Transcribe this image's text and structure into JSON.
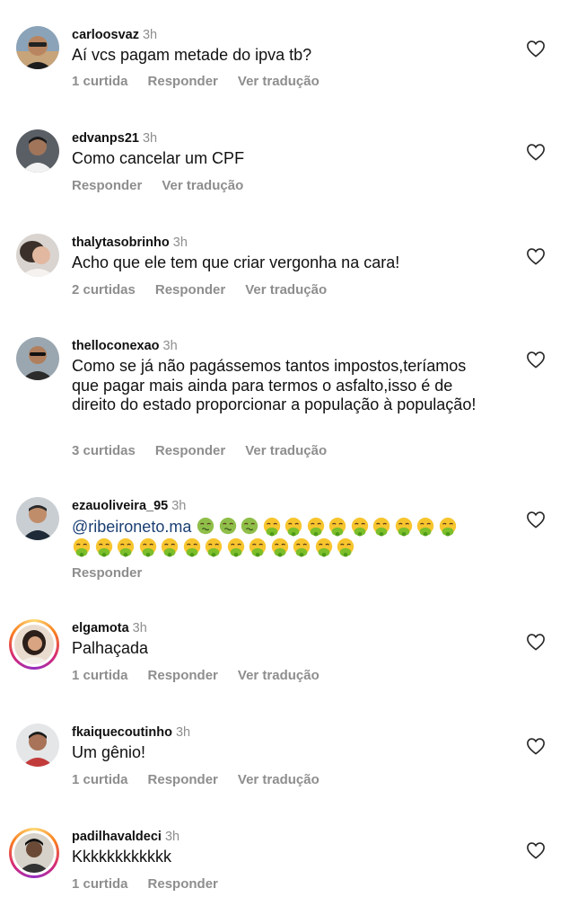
{
  "comments": [
    {
      "username": "carloosvaz",
      "time": "3h",
      "text": "Aí vcs pagam metade do ipva tb?",
      "likes": "1 curtida",
      "reply": "Responder",
      "translate": "Ver tradução"
    },
    {
      "username": "edvanps21",
      "time": "3h",
      "text": "Como cancelar um CPF",
      "reply": "Responder",
      "translate": "Ver tradução"
    },
    {
      "username": "thalytasobrinho",
      "time": "3h",
      "text": "Acho que ele tem que criar vergonha na cara!",
      "likes": "2 curtidas",
      "reply": "Responder",
      "translate": "Ver tradução"
    },
    {
      "username": "thelloconexao",
      "time": "3h",
      "text": "Como se já não pagássemos tantos impostos,teríamos que pagar mais ainda para termos o asfalto,isso é de direito do estado proporcionar a população à população!",
      "likes": "3 curtidas",
      "reply": "Responder",
      "translate": "Ver tradução"
    },
    {
      "username": "ezauoliveira_95",
      "time": "3h",
      "mention": "@ribeironeto.ma",
      "emoji": {
        "nauseated": 3,
        "vomiting": 9,
        "vomiting_line2": 13
      },
      "reply": "Responder"
    },
    {
      "username": "elgamota",
      "time": "3h",
      "text": "Palhaçada",
      "likes": "1 curtida",
      "reply": "Responder",
      "translate": "Ver tradução"
    },
    {
      "username": "fkaiquecoutinho",
      "time": "3h",
      "text": "Um gênio!",
      "likes": "1 curtida",
      "reply": "Responder",
      "translate": "Ver tradução"
    },
    {
      "username": "padilhavaldeci",
      "time": "3h",
      "text": "Kkkkkkkkkkkk",
      "likes": "1 curtida",
      "reply": "Responder"
    }
  ],
  "icons": {
    "like": "heart-outline-icon"
  },
  "colors": {
    "muted": "#8e8e8e",
    "mention": "#1a3f73"
  }
}
